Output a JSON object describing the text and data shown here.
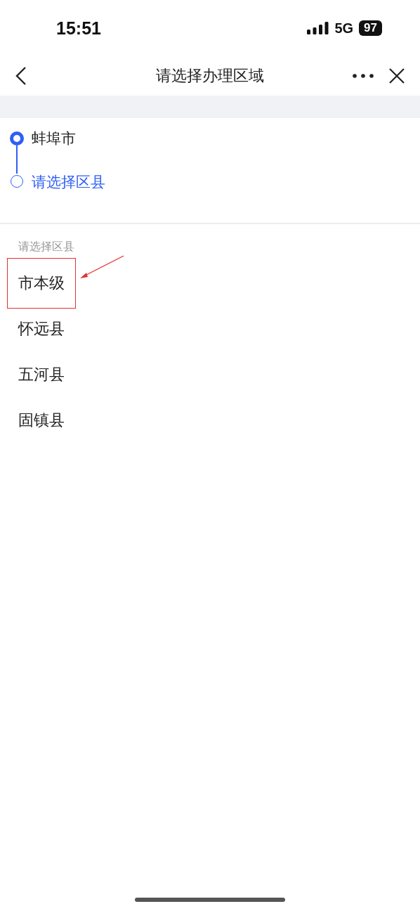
{
  "status_bar": {
    "time": "15:51",
    "network": "5G",
    "battery": "97"
  },
  "nav": {
    "title": "请选择办理区域"
  },
  "steps": [
    {
      "label": "蚌埠市",
      "current": false
    },
    {
      "label": "请选择区县",
      "current": true
    }
  ],
  "list": {
    "heading": "请选择区县",
    "items": [
      {
        "label": "市本级",
        "annotated": true
      },
      {
        "label": "怀远县",
        "annotated": false
      },
      {
        "label": "五河县",
        "annotated": false
      },
      {
        "label": "固镇县",
        "annotated": false
      }
    ]
  }
}
